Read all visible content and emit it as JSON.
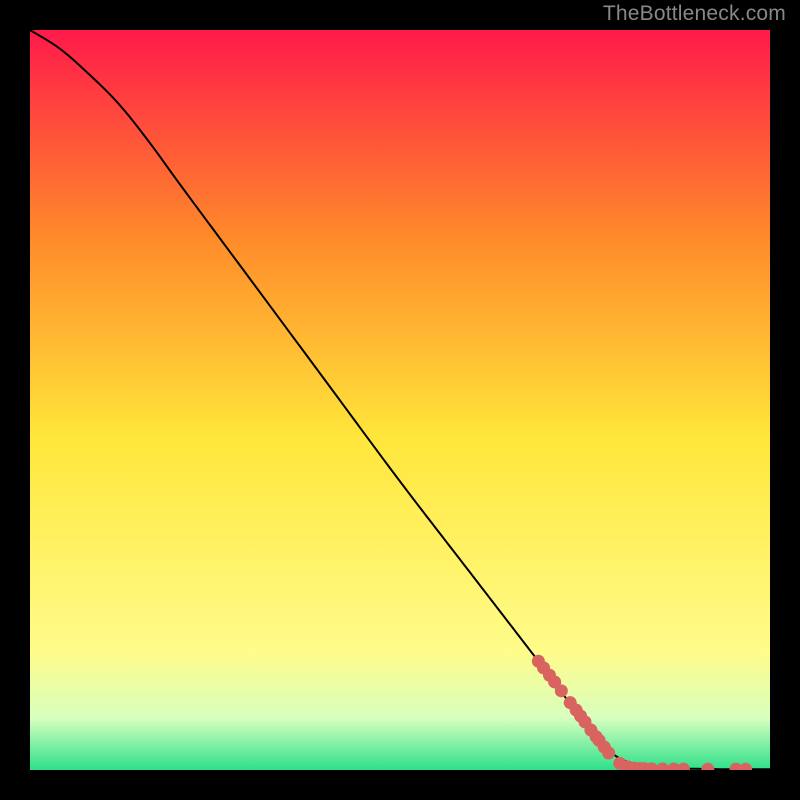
{
  "attribution": "TheBottleneck.com",
  "colors": {
    "page_bg": "#000000",
    "gradient_top": "#ff1a4a",
    "gradient_mid_upper": "#ff8a2a",
    "gradient_mid": "#ffe63a",
    "gradient_low": "#fffc8a",
    "gradient_lower": "#d7ffbf",
    "gradient_bottom": "#2ee08a",
    "line": "#000000",
    "marker": "#d8635f",
    "attribution_text": "#888888"
  },
  "chart_data": {
    "type": "line",
    "title": "",
    "xlabel": "",
    "ylabel": "",
    "xlim": [
      0,
      100
    ],
    "ylim": [
      0,
      100
    ],
    "grid": false,
    "legend": false,
    "series": [
      {
        "name": "curve",
        "x": [
          0,
          4,
          8,
          12,
          16,
          20,
          30,
          40,
          50,
          60,
          70,
          77,
          79,
          81,
          83,
          85,
          88,
          91,
          94,
          97,
          100
        ],
        "y": [
          100,
          97.5,
          94,
          90,
          85,
          79.5,
          66,
          52.5,
          39,
          26,
          13,
          3.8,
          2.0,
          1.0,
          0.5,
          0.3,
          0.2,
          0.15,
          0.1,
          0.1,
          0.1
        ]
      }
    ],
    "markers": [
      {
        "name": "scatter-points",
        "points": [
          {
            "x": 68.7,
            "y": 14.7
          },
          {
            "x": 69.4,
            "y": 13.8
          },
          {
            "x": 70.2,
            "y": 12.8
          },
          {
            "x": 70.9,
            "y": 11.9
          },
          {
            "x": 71.8,
            "y": 10.7
          },
          {
            "x": 73.0,
            "y": 9.1
          },
          {
            "x": 73.8,
            "y": 8.1
          },
          {
            "x": 74.4,
            "y": 7.3
          },
          {
            "x": 75.0,
            "y": 6.5
          },
          {
            "x": 75.8,
            "y": 5.4
          },
          {
            "x": 76.5,
            "y": 4.5
          },
          {
            "x": 76.9,
            "y": 4.0
          },
          {
            "x": 77.6,
            "y": 3.1
          },
          {
            "x": 78.2,
            "y": 2.3
          },
          {
            "x": 79.7,
            "y": 0.9
          },
          {
            "x": 80.8,
            "y": 0.4
          },
          {
            "x": 81.6,
            "y": 0.25
          },
          {
            "x": 82.4,
            "y": 0.2
          },
          {
            "x": 83.0,
            "y": 0.18
          },
          {
            "x": 84.0,
            "y": 0.16
          },
          {
            "x": 85.5,
            "y": 0.14
          },
          {
            "x": 87.0,
            "y": 0.13
          },
          {
            "x": 88.3,
            "y": 0.12
          },
          {
            "x": 91.6,
            "y": 0.11
          },
          {
            "x": 95.4,
            "y": 0.1
          },
          {
            "x": 96.7,
            "y": 0.1
          }
        ]
      }
    ]
  }
}
